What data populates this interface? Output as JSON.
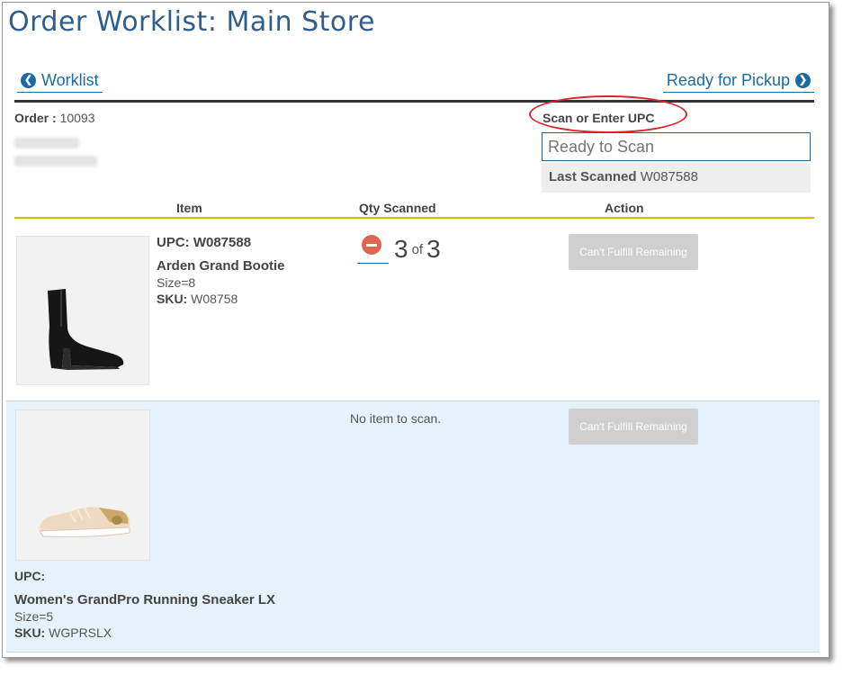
{
  "page": {
    "title": "Order Worklist: Main Store"
  },
  "nav": {
    "back_label": "Worklist",
    "forward_label": "Ready for Pickup"
  },
  "order": {
    "label": "Order :",
    "number": "10093"
  },
  "scan": {
    "label": "Scan or Enter UPC",
    "placeholder": "Ready to Scan",
    "last_scanned_label": "Last Scanned",
    "last_scanned_value": "W087588"
  },
  "table": {
    "headers": [
      "Item",
      "Qty Scanned",
      "Action"
    ]
  },
  "items": [
    {
      "upc_label": "UPC:",
      "upc_value": "W087588",
      "name": "Arden Grand Bootie",
      "size": "Size=8",
      "sku_label": "SKU:",
      "sku_value": "W08758",
      "qty_scanned": "3",
      "qty_of": "of",
      "qty_total": "3",
      "action_label": "Can't Fulfill Remaining"
    },
    {
      "upc_label": "UPC:",
      "upc_value": "",
      "name": "Women's GrandPro Running Sneaker LX",
      "size": "Size=5",
      "sku_label": "SKU:",
      "sku_value": "WGPRSLX",
      "no_item_text": "No item to scan.",
      "action_label": "Can't Fulfill Remaining"
    }
  ],
  "icons": {
    "back": "chevron-left-circle-icon",
    "forward": "chevron-right-circle-icon",
    "decrement": "minus-circle-icon"
  },
  "colors": {
    "accent": "#1b6aa5",
    "title": "#2f5d8c",
    "highlight_row": "#e6f2fb",
    "divider_yellow": "#c8c812",
    "annotation_red": "#d9262c",
    "minus_icon": "#e0664f",
    "disabled_button": "#cfcfcf"
  }
}
